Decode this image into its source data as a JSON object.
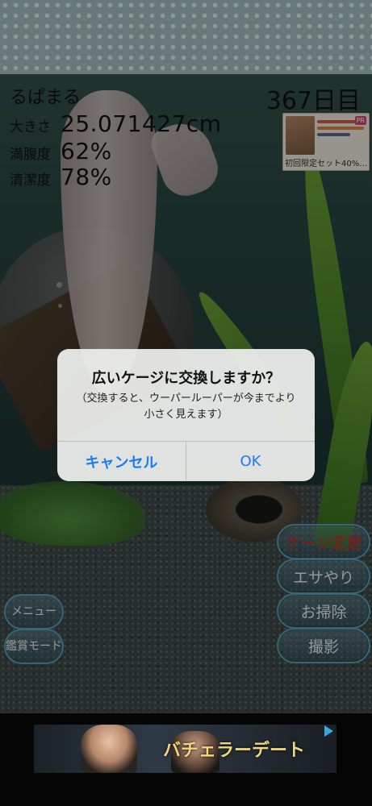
{
  "pet": {
    "name": "るぱまる",
    "day_counter": "367日目"
  },
  "stats": [
    {
      "label": "大きさ",
      "value": "25.071427cm"
    },
    {
      "label": "満腹度",
      "value": "62%"
    },
    {
      "label": "清潔度",
      "value": "78%"
    }
  ],
  "top_ad": {
    "badge": "PR",
    "caption": "初回限定セット40%…"
  },
  "right_buttons": [
    {
      "label": "ケージ変更",
      "color": "#e02818"
    },
    {
      "label": "エサやり"
    },
    {
      "label": "お掃除"
    },
    {
      "label": "撮影"
    }
  ],
  "left_buttons": [
    {
      "label": "メニュー"
    },
    {
      "label": "鑑賞モード"
    }
  ],
  "dialog": {
    "title": "広いケージに交換しますか？",
    "message": "（交換すると、ウーパールーパーが今までより小さく見えます）",
    "cancel_label": "キャンセル",
    "ok_label": "OK",
    "accent_color": "#1a7cf0"
  },
  "bottom_ad": {
    "headline": "バチェラーデート"
  },
  "icons": [
    "adchoices-icon"
  ]
}
